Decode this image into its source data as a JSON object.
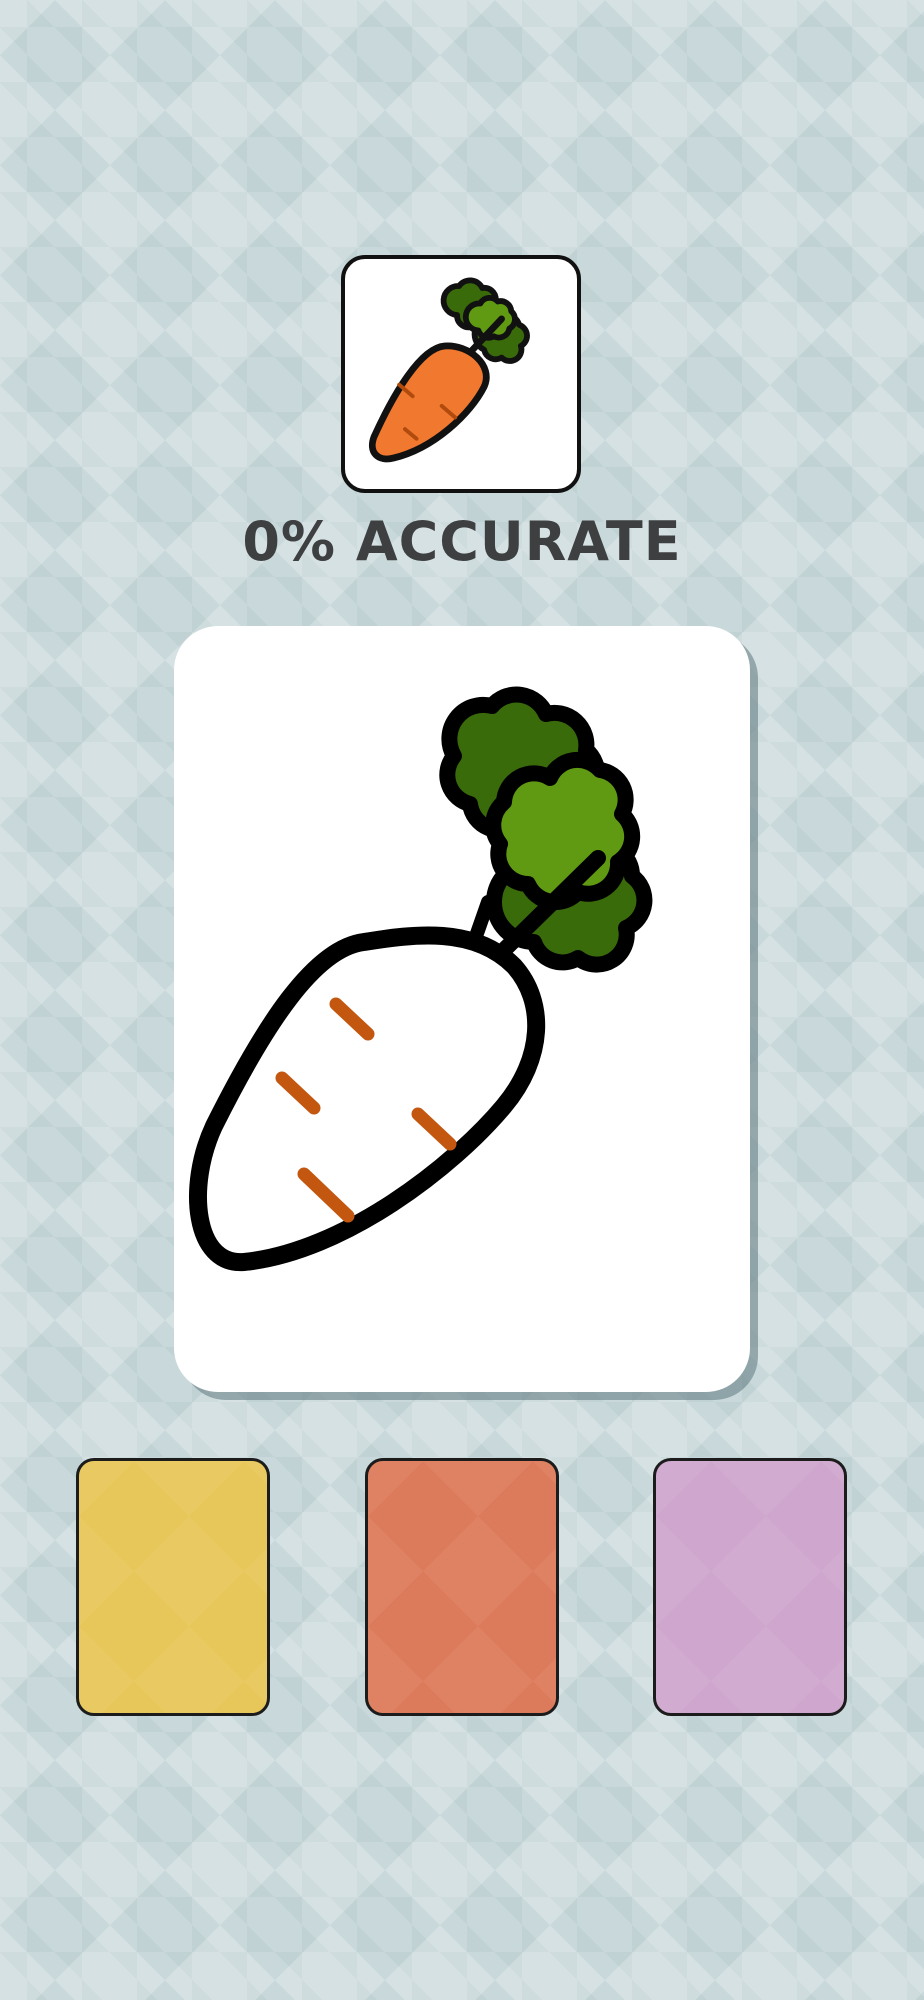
{
  "header": {
    "accuracy_text": "0% ACCURATE"
  },
  "reference": {
    "subject_icon": "carrot-icon",
    "body_color": "#f0782f",
    "leaf_dark_color": "#3a6b0a",
    "leaf_light_color": "#5f9a12"
  },
  "canvas": {
    "subject_icon": "carrot-outline-icon",
    "body_fill_color": "#ffffff",
    "mark_color": "#c4570f",
    "leaf_dark_color": "#3a6b0a",
    "leaf_light_color": "#5f9a12"
  },
  "palette": {
    "swatches": [
      {
        "color": "#e8c75a"
      },
      {
        "color": "#dc7b5b"
      },
      {
        "color": "#cfa6cd"
      }
    ]
  }
}
